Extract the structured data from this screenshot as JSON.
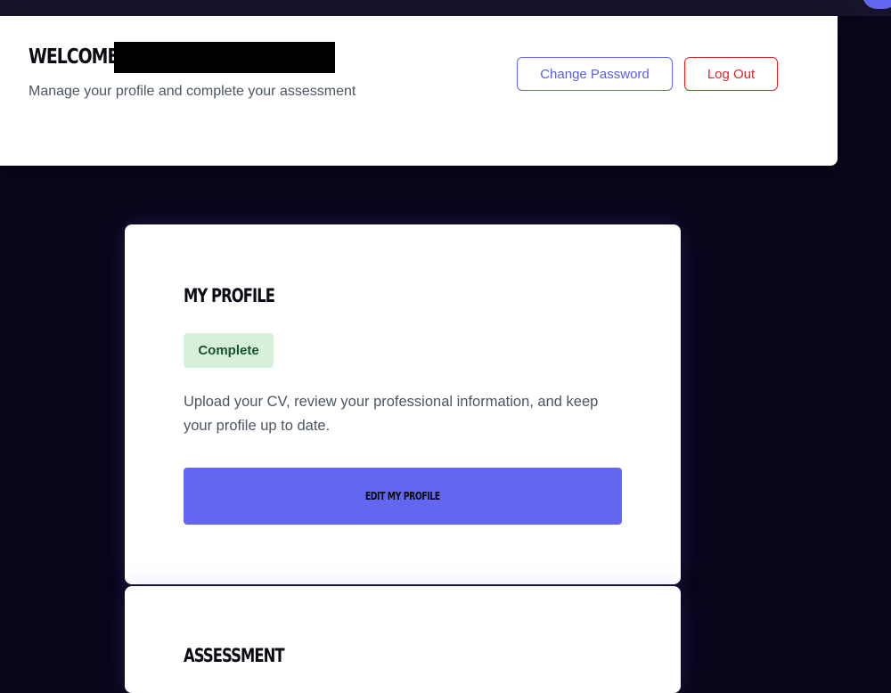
{
  "header": {
    "welcome_label": "WELCOME,",
    "subtitle": "Manage your profile and complete your assessment",
    "change_password_label": "Change Password",
    "logout_label": "Log Out"
  },
  "profile_card": {
    "title": "MY PROFILE",
    "status": "Complete",
    "description": "Upload your CV, review your professional information, and keep your profile up to date.",
    "button_label": "EDIT MY PROFILE"
  },
  "assessment_card": {
    "title": "ASSESSMENT"
  },
  "colors": {
    "page_background": "#08061a",
    "accent": "#6366f1",
    "danger": "#dc2626",
    "status_complete_bg": "#d6f0dc",
    "status_complete_text": "#14532d"
  }
}
